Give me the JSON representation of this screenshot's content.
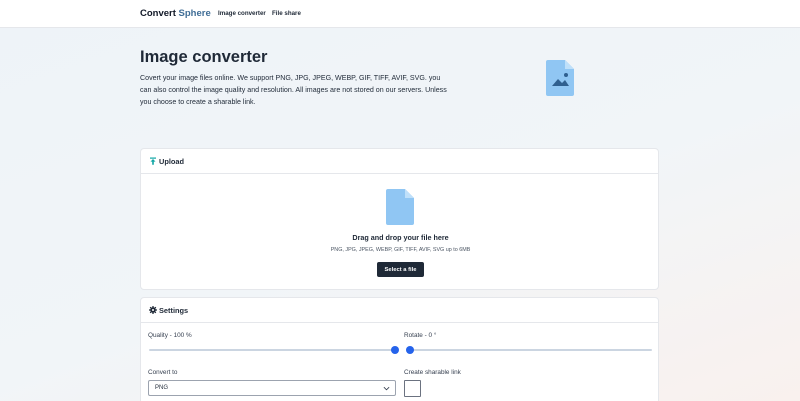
{
  "navbar": {
    "brand_main": "Convert",
    "brand_accent": "Sphere",
    "links": [
      "Image converter",
      "File share"
    ]
  },
  "hero": {
    "title": "Image converter",
    "description": "Covert your image files online. We support PNG, JPG, JPEG, WEBP, GIF, TIFF, AVIF, SVG. you can also control the image quality and resolution. All images are not stored on our servers. Unless you choose to create a sharable link.",
    "icon": "image-file-icon"
  },
  "upload": {
    "title": "Upload",
    "icon": "upload-icon",
    "drop_title": "Drag and drop your file here",
    "formats": "PNG, JPG, JPEG, WEBP, GIF, TIFF, AVIF, SVG up to 6MB",
    "button_label": "Select a file"
  },
  "settings": {
    "title": "Settings",
    "icon": "gear-icon",
    "quality_label": "Quality - 100 %",
    "quality_value": 100,
    "rotate_label": "Rotate - 0 °",
    "rotate_value": 0,
    "convert_label": "Convert to",
    "convert_value": "PNG",
    "share_label": "Create sharable link"
  },
  "colors": {
    "accent": "#2563eb",
    "brand_accent": "#3f6d96",
    "icon_fill": "#90c6f3",
    "button_bg": "#1f2937"
  }
}
